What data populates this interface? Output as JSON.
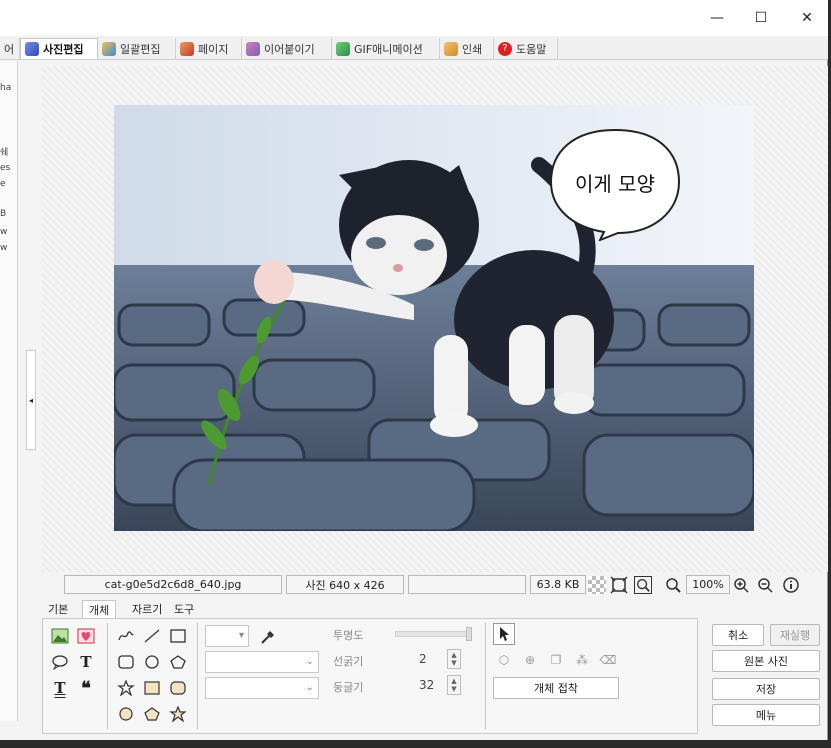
{
  "window": {
    "minimize_symbol": "—",
    "maximize_symbol": "☐",
    "close_symbol": "✕"
  },
  "tabs": [
    {
      "label": "어",
      "icon": "partial-tab-icon"
    },
    {
      "label": "사진편집",
      "icon": "photo-edit-icon",
      "color": "#5b6fd6",
      "active": true
    },
    {
      "label": "일괄편집",
      "icon": "batch-edit-icon",
      "color": "#3a8ad8"
    },
    {
      "label": "페이지",
      "icon": "page-icon",
      "color": "#c0392b"
    },
    {
      "label": "이어붙이기",
      "icon": "merge-icon",
      "color": "#7b5fc0"
    },
    {
      "label": "GIF애니메이션",
      "icon": "gif-icon",
      "color": "#2e8b57"
    },
    {
      "label": "인쇄",
      "icon": "print-icon",
      "color": "#d18a2a"
    },
    {
      "label": "도움말",
      "icon": "help-icon",
      "color": "#e02020"
    }
  ],
  "left_panel_fragments": [
    "ha",
    "쉐",
    "es",
    "e",
    "B",
    "w",
    "w"
  ],
  "speech_bubble": {
    "text": "이게 모양"
  },
  "status": {
    "filename": "cat-g0e5d2c6d8_640.jpg",
    "dimensions": "사진 640 x 426",
    "extra": "",
    "filesize": "63.8 KB",
    "zoom": "100%"
  },
  "bottom_tabs": [
    "기본",
    "개체",
    "자르기",
    "도구"
  ],
  "active_bottom_tab": "개체",
  "properties": {
    "opacity_label": "투명도",
    "opacity_value": 1.0,
    "line_thickness_label": "선굵기",
    "line_thickness_value": "2",
    "roundness_label": "둥글기",
    "roundness_value": "32"
  },
  "object_buttons": {
    "paste_object": "개체 접착"
  },
  "right_buttons": {
    "cancel": "취소",
    "redo": "재실행",
    "original_photo": "원본 사진",
    "save": "저장",
    "menu": "메뉴"
  },
  "colors": {
    "accent_blue": "#2f57d9",
    "panel_bg": "#f3f3f3",
    "border": "#c8c8c8"
  }
}
